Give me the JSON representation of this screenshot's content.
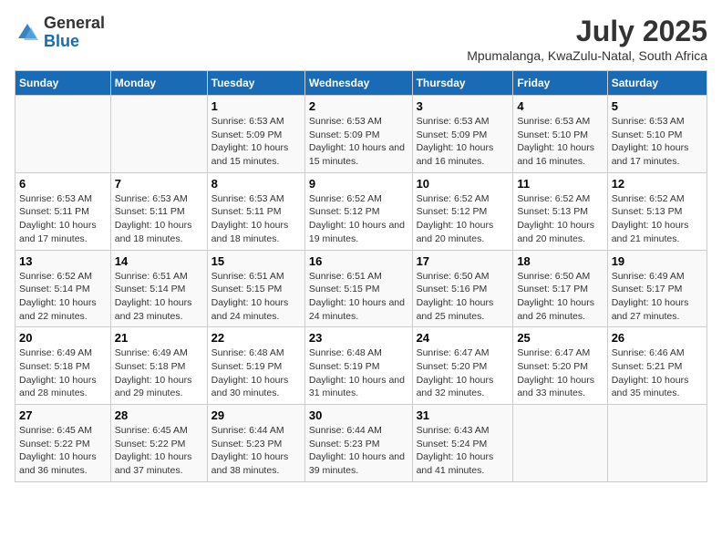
{
  "header": {
    "logo_general": "General",
    "logo_blue": "Blue",
    "main_title": "July 2025",
    "subtitle": "Mpumalanga, KwaZulu-Natal, South Africa"
  },
  "days_of_week": [
    "Sunday",
    "Monday",
    "Tuesday",
    "Wednesday",
    "Thursday",
    "Friday",
    "Saturday"
  ],
  "weeks": [
    [
      {
        "day": "",
        "info": ""
      },
      {
        "day": "",
        "info": ""
      },
      {
        "day": "1",
        "info": "Sunrise: 6:53 AM\nSunset: 5:09 PM\nDaylight: 10 hours and 15 minutes."
      },
      {
        "day": "2",
        "info": "Sunrise: 6:53 AM\nSunset: 5:09 PM\nDaylight: 10 hours and 15 minutes."
      },
      {
        "day": "3",
        "info": "Sunrise: 6:53 AM\nSunset: 5:09 PM\nDaylight: 10 hours and 16 minutes."
      },
      {
        "day": "4",
        "info": "Sunrise: 6:53 AM\nSunset: 5:10 PM\nDaylight: 10 hours and 16 minutes."
      },
      {
        "day": "5",
        "info": "Sunrise: 6:53 AM\nSunset: 5:10 PM\nDaylight: 10 hours and 17 minutes."
      }
    ],
    [
      {
        "day": "6",
        "info": "Sunrise: 6:53 AM\nSunset: 5:11 PM\nDaylight: 10 hours and 17 minutes."
      },
      {
        "day": "7",
        "info": "Sunrise: 6:53 AM\nSunset: 5:11 PM\nDaylight: 10 hours and 18 minutes."
      },
      {
        "day": "8",
        "info": "Sunrise: 6:53 AM\nSunset: 5:11 PM\nDaylight: 10 hours and 18 minutes."
      },
      {
        "day": "9",
        "info": "Sunrise: 6:52 AM\nSunset: 5:12 PM\nDaylight: 10 hours and 19 minutes."
      },
      {
        "day": "10",
        "info": "Sunrise: 6:52 AM\nSunset: 5:12 PM\nDaylight: 10 hours and 20 minutes."
      },
      {
        "day": "11",
        "info": "Sunrise: 6:52 AM\nSunset: 5:13 PM\nDaylight: 10 hours and 20 minutes."
      },
      {
        "day": "12",
        "info": "Sunrise: 6:52 AM\nSunset: 5:13 PM\nDaylight: 10 hours and 21 minutes."
      }
    ],
    [
      {
        "day": "13",
        "info": "Sunrise: 6:52 AM\nSunset: 5:14 PM\nDaylight: 10 hours and 22 minutes."
      },
      {
        "day": "14",
        "info": "Sunrise: 6:51 AM\nSunset: 5:14 PM\nDaylight: 10 hours and 23 minutes."
      },
      {
        "day": "15",
        "info": "Sunrise: 6:51 AM\nSunset: 5:15 PM\nDaylight: 10 hours and 24 minutes."
      },
      {
        "day": "16",
        "info": "Sunrise: 6:51 AM\nSunset: 5:15 PM\nDaylight: 10 hours and 24 minutes."
      },
      {
        "day": "17",
        "info": "Sunrise: 6:50 AM\nSunset: 5:16 PM\nDaylight: 10 hours and 25 minutes."
      },
      {
        "day": "18",
        "info": "Sunrise: 6:50 AM\nSunset: 5:17 PM\nDaylight: 10 hours and 26 minutes."
      },
      {
        "day": "19",
        "info": "Sunrise: 6:49 AM\nSunset: 5:17 PM\nDaylight: 10 hours and 27 minutes."
      }
    ],
    [
      {
        "day": "20",
        "info": "Sunrise: 6:49 AM\nSunset: 5:18 PM\nDaylight: 10 hours and 28 minutes."
      },
      {
        "day": "21",
        "info": "Sunrise: 6:49 AM\nSunset: 5:18 PM\nDaylight: 10 hours and 29 minutes."
      },
      {
        "day": "22",
        "info": "Sunrise: 6:48 AM\nSunset: 5:19 PM\nDaylight: 10 hours and 30 minutes."
      },
      {
        "day": "23",
        "info": "Sunrise: 6:48 AM\nSunset: 5:19 PM\nDaylight: 10 hours and 31 minutes."
      },
      {
        "day": "24",
        "info": "Sunrise: 6:47 AM\nSunset: 5:20 PM\nDaylight: 10 hours and 32 minutes."
      },
      {
        "day": "25",
        "info": "Sunrise: 6:47 AM\nSunset: 5:20 PM\nDaylight: 10 hours and 33 minutes."
      },
      {
        "day": "26",
        "info": "Sunrise: 6:46 AM\nSunset: 5:21 PM\nDaylight: 10 hours and 35 minutes."
      }
    ],
    [
      {
        "day": "27",
        "info": "Sunrise: 6:45 AM\nSunset: 5:22 PM\nDaylight: 10 hours and 36 minutes."
      },
      {
        "day": "28",
        "info": "Sunrise: 6:45 AM\nSunset: 5:22 PM\nDaylight: 10 hours and 37 minutes."
      },
      {
        "day": "29",
        "info": "Sunrise: 6:44 AM\nSunset: 5:23 PM\nDaylight: 10 hours and 38 minutes."
      },
      {
        "day": "30",
        "info": "Sunrise: 6:44 AM\nSunset: 5:23 PM\nDaylight: 10 hours and 39 minutes."
      },
      {
        "day": "31",
        "info": "Sunrise: 6:43 AM\nSunset: 5:24 PM\nDaylight: 10 hours and 41 minutes."
      },
      {
        "day": "",
        "info": ""
      },
      {
        "day": "",
        "info": ""
      }
    ]
  ]
}
